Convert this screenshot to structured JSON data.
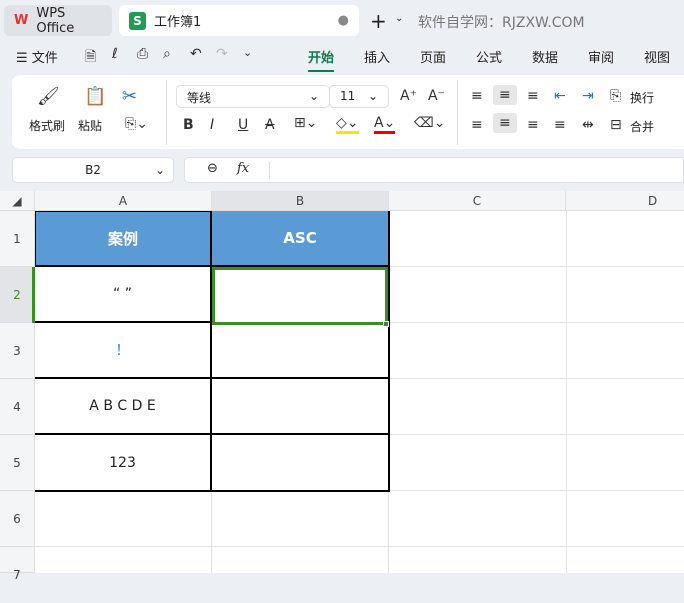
{
  "tabs": {
    "home": "WPS Office",
    "doc": "工作簿1",
    "watermark": "软件自学网：RJZXW.COM"
  },
  "menu": {
    "file": "文件",
    "items": [
      "开始",
      "插入",
      "页面",
      "公式",
      "数据",
      "审阅",
      "视图"
    ]
  },
  "ribbon": {
    "format_painter": "格式刷",
    "paste": "粘贴",
    "font": "等线",
    "size": "11",
    "wrap": "换行",
    "merge": "合并",
    "bold": "B",
    "italic": "I",
    "underline": "U"
  },
  "formula": {
    "cell_ref": "B2",
    "fx": "fx",
    "value": ""
  },
  "columns": [
    "A",
    "B",
    "C",
    "D"
  ],
  "rows": [
    "1",
    "2",
    "3",
    "4",
    "5",
    "6",
    "7"
  ],
  "table": {
    "headers": [
      "案例",
      "ASC"
    ],
    "cells": [
      "“ ”",
      "！",
      "A B C D E",
      "123"
    ]
  },
  "colors": {
    "header_fill": "#5b9bd5",
    "selection": "#3c8c28",
    "accent": "#0f7b4f"
  }
}
